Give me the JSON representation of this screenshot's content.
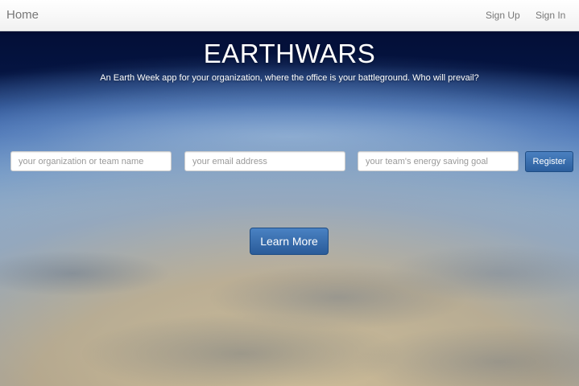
{
  "navbar": {
    "brand": "Home",
    "links": [
      "Sign Up",
      "Sign In"
    ]
  },
  "hero": {
    "title": "EARTHWARS",
    "subtitle": "An Earth Week app for your organization, where the office is your battleground. Who will prevail?"
  },
  "form": {
    "org_placeholder": "your organization or team name",
    "email_placeholder": "your email address",
    "goal_placeholder": "your team's energy saving goal",
    "register_label": "Register"
  },
  "cta": {
    "learn_more_label": "Learn More"
  },
  "colors": {
    "primary_button": "#2c5f9e",
    "navbar_text": "#777777"
  }
}
